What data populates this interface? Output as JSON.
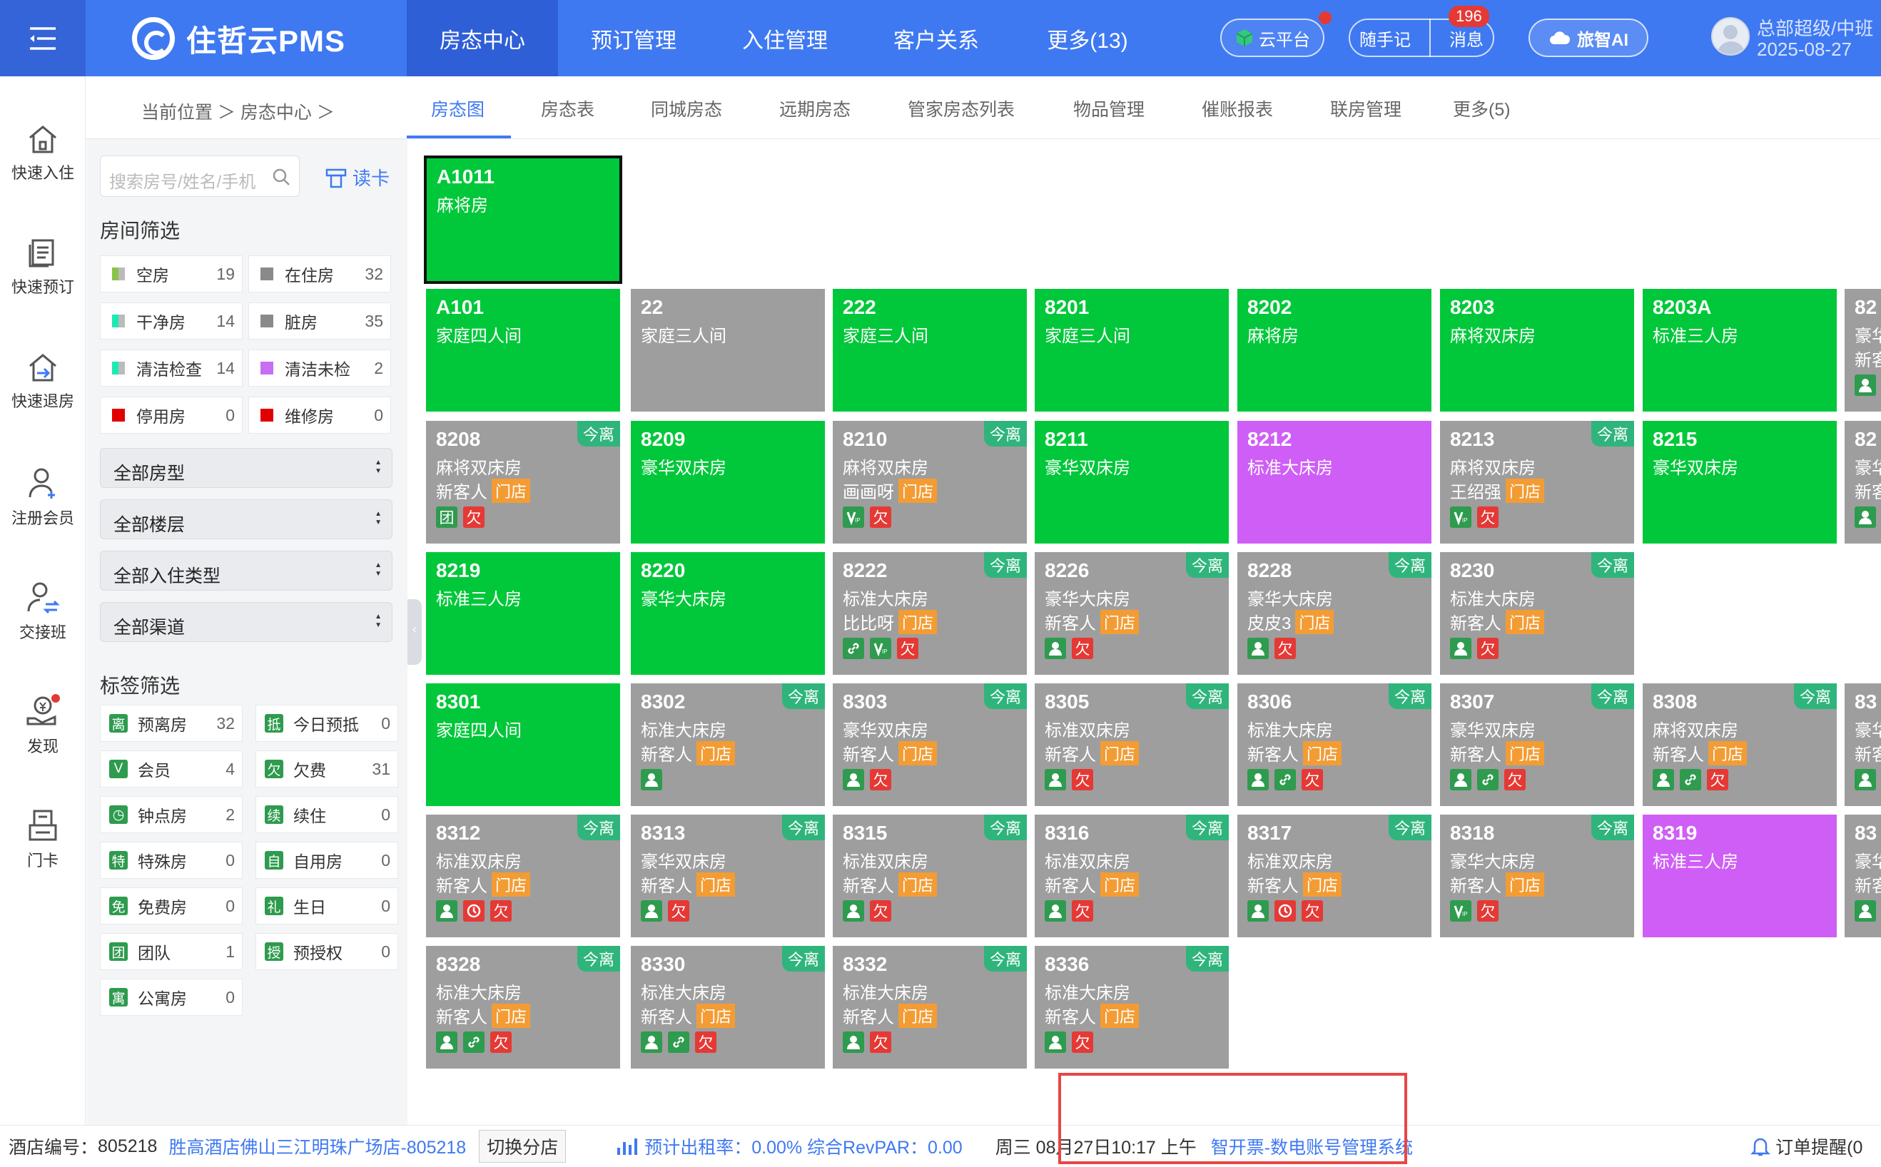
{
  "topbar": {
    "logo_text": "住哲云PMS",
    "nav": [
      "房态中心",
      "预订管理",
      "入住管理",
      "客户关系",
      "更多(13)"
    ],
    "active_nav": "房态中心",
    "cloud_platform": "云平台",
    "note": "随手记",
    "message": "消息",
    "message_badge": "196",
    "ai_label": "旅智AI",
    "user_name": "总部超级/中班",
    "user_date": "2025-08-27"
  },
  "rail": [
    "快速入住",
    "快速预订",
    "快速退房",
    "注册会员",
    "交接班",
    "发现",
    "门卡"
  ],
  "breadcrumb": "当前位置 ＞ 房态中心 ＞",
  "subtabs": [
    "房态图",
    "房态表",
    "同城房态",
    "远期房态",
    "管家房态列表",
    "物品管理",
    "催账报表",
    "联房管理",
    "更多(5)"
  ],
  "filter": {
    "search_placeholder": "搜索房号/姓名/手机",
    "read_card": "读卡",
    "room_filter_title": "房间筛选",
    "stats": [
      {
        "label": "空房",
        "count": "19",
        "color": "#8bc34a"
      },
      {
        "label": "在住房",
        "count": "32",
        "color": "#8a8a8a"
      },
      {
        "label": "干净房",
        "count": "14",
        "color": "#1de9b6"
      },
      {
        "label": "脏房",
        "count": "35",
        "color": "#8a8a8a"
      },
      {
        "label": "清洁检查",
        "count": "14",
        "color": "#1de9b6"
      },
      {
        "label": "清洁未检",
        "count": "2",
        "color": "#c76ef5"
      },
      {
        "label": "停用房",
        "count": "0",
        "color": "#e00000"
      },
      {
        "label": "维修房",
        "count": "0",
        "color": "#e00000"
      }
    ],
    "selects": [
      "全部房型",
      "全部楼层",
      "全部入住类型",
      "全部渠道"
    ],
    "tag_filter_title": "标签筛选",
    "tags": [
      {
        "icon": "离",
        "label": "预离房",
        "count": "32"
      },
      {
        "icon": "抵",
        "label": "今日预抵",
        "count": "0"
      },
      {
        "icon": "V",
        "label": "会员",
        "count": "4"
      },
      {
        "icon": "欠",
        "label": "欠费",
        "count": "31"
      },
      {
        "icon": "◷",
        "label": "钟点房",
        "count": "2"
      },
      {
        "icon": "续",
        "label": "续住",
        "count": "0"
      },
      {
        "icon": "特",
        "label": "特殊房",
        "count": "0"
      },
      {
        "icon": "自",
        "label": "自用房",
        "count": "0"
      },
      {
        "icon": "免",
        "label": "免费房",
        "count": "0"
      },
      {
        "icon": "礼",
        "label": "生日",
        "count": "0"
      },
      {
        "icon": "团",
        "label": "团队",
        "count": "1"
      },
      {
        "icon": "授",
        "label": "预授权",
        "count": "0"
      },
      {
        "icon": "寓",
        "label": "公寓房",
        "count": "0"
      }
    ]
  },
  "rooms": [
    {
      "num": "A1011",
      "type": "麻将房",
      "color": "green",
      "selected": true
    },
    {
      "num": "A101",
      "type": "家庭四人间",
      "color": "green"
    },
    {
      "num": "22",
      "type": "家庭三人间",
      "color": "gray"
    },
    {
      "num": "222",
      "type": "家庭三人间",
      "color": "green"
    },
    {
      "num": "8201",
      "type": "家庭三人间",
      "color": "green"
    },
    {
      "num": "8202",
      "type": "麻将房",
      "color": "green"
    },
    {
      "num": "8203",
      "type": "麻将双床房",
      "color": "green"
    },
    {
      "num": "8203A",
      "type": "标准三人房",
      "color": "green"
    },
    {
      "num": "82",
      "type": "豪华",
      "guest": "新客",
      "color": "gray",
      "icons": [
        "person"
      ]
    },
    {
      "num": "8208",
      "type": "麻将双床房",
      "guest": "新客人",
      "store": true,
      "leave": true,
      "color": "gray",
      "icons": [
        "team",
        "owe"
      ]
    },
    {
      "num": "8209",
      "type": "豪华双床房",
      "color": "green"
    },
    {
      "num": "8210",
      "type": "麻将双床房",
      "guest": "画画呀",
      "store": true,
      "leave": true,
      "color": "gray",
      "icons": [
        "vip",
        "owe"
      ]
    },
    {
      "num": "8211",
      "type": "豪华双床房",
      "color": "green"
    },
    {
      "num": "8212",
      "type": "标准大床房",
      "color": "purple"
    },
    {
      "num": "8213",
      "type": "麻将双床房",
      "guest": "王绍强",
      "store": true,
      "leave": true,
      "color": "gray",
      "icons": [
        "vip",
        "owe"
      ]
    },
    {
      "num": "8215",
      "type": "豪华双床房",
      "color": "green"
    },
    {
      "num": "82",
      "type": "豪华",
      "guest": "新客",
      "color": "gray",
      "icons": [
        "person"
      ]
    },
    {
      "num": "8219",
      "type": "标准三人房",
      "color": "green"
    },
    {
      "num": "8220",
      "type": "豪华大床房",
      "color": "green"
    },
    {
      "num": "8222",
      "type": "标准大床房",
      "guest": "比比呀",
      "store": true,
      "leave": true,
      "color": "gray",
      "icons": [
        "link",
        "vip",
        "owe"
      ]
    },
    {
      "num": "8226",
      "type": "豪华大床房",
      "guest": "新客人",
      "store": true,
      "leave": true,
      "color": "gray",
      "icons": [
        "person",
        "owe"
      ]
    },
    {
      "num": "8228",
      "type": "豪华大床房",
      "guest": "皮皮3",
      "store": true,
      "leave": true,
      "color": "gray",
      "icons": [
        "person",
        "owe"
      ]
    },
    {
      "num": "8230",
      "type": "标准大床房",
      "guest": "新客人",
      "store": true,
      "leave": true,
      "color": "gray",
      "icons": [
        "person",
        "owe"
      ]
    },
    {
      "num": "8301",
      "type": "家庭四人间",
      "color": "green"
    },
    {
      "num": "8302",
      "type": "标准大床房",
      "guest": "新客人",
      "store": true,
      "leave": true,
      "color": "gray",
      "icons": [
        "person"
      ]
    },
    {
      "num": "8303",
      "type": "豪华双床房",
      "guest": "新客人",
      "store": true,
      "leave": true,
      "color": "gray",
      "icons": [
        "person",
        "owe"
      ]
    },
    {
      "num": "8305",
      "type": "标准双床房",
      "guest": "新客人",
      "store": true,
      "leave": true,
      "color": "gray",
      "icons": [
        "person",
        "owe"
      ]
    },
    {
      "num": "8306",
      "type": "标准大床房",
      "guest": "新客人",
      "store": true,
      "leave": true,
      "color": "gray",
      "icons": [
        "person",
        "link",
        "owe"
      ]
    },
    {
      "num": "8307",
      "type": "豪华双床房",
      "guest": "新客人",
      "store": true,
      "leave": true,
      "color": "gray",
      "icons": [
        "person",
        "link",
        "owe"
      ]
    },
    {
      "num": "8308",
      "type": "麻将双床房",
      "guest": "新客人",
      "store": true,
      "leave": true,
      "color": "gray",
      "icons": [
        "person",
        "link",
        "owe"
      ]
    },
    {
      "num": "83",
      "type": "豪华",
      "guest": "新客",
      "color": "gray",
      "icons": [
        "person"
      ]
    },
    {
      "num": "8312",
      "type": "标准双床房",
      "guest": "新客人",
      "store": true,
      "leave": true,
      "color": "gray",
      "icons": [
        "person",
        "clock",
        "owe"
      ]
    },
    {
      "num": "8313",
      "type": "豪华双床房",
      "guest": "新客人",
      "store": true,
      "leave": true,
      "color": "gray",
      "icons": [
        "person",
        "owe"
      ]
    },
    {
      "num": "8315",
      "type": "标准双床房",
      "guest": "新客人",
      "store": true,
      "leave": true,
      "color": "gray",
      "icons": [
        "person",
        "owe"
      ]
    },
    {
      "num": "8316",
      "type": "标准双床房",
      "guest": "新客人",
      "store": true,
      "leave": true,
      "color": "gray",
      "icons": [
        "person",
        "owe"
      ]
    },
    {
      "num": "8317",
      "type": "标准双床房",
      "guest": "新客人",
      "store": true,
      "leave": true,
      "color": "gray",
      "icons": [
        "person",
        "clock",
        "owe"
      ]
    },
    {
      "num": "8318",
      "type": "豪华大床房",
      "guest": "新客人",
      "store": true,
      "leave": true,
      "color": "gray",
      "icons": [
        "vip",
        "owe"
      ]
    },
    {
      "num": "8319",
      "type": "标准三人房",
      "color": "purple"
    },
    {
      "num": "83",
      "type": "豪华",
      "guest": "新客",
      "color": "gray",
      "icons": [
        "person"
      ]
    },
    {
      "num": "8328",
      "type": "标准大床房",
      "guest": "新客人",
      "store": true,
      "leave": true,
      "color": "gray",
      "icons": [
        "person",
        "link",
        "owe"
      ]
    },
    {
      "num": "8330",
      "type": "标准大床房",
      "guest": "新客人",
      "store": true,
      "leave": true,
      "color": "gray",
      "icons": [
        "person",
        "link",
        "owe"
      ]
    },
    {
      "num": "8332",
      "type": "标准大床房",
      "guest": "新客人",
      "store": true,
      "leave": true,
      "color": "gray",
      "icons": [
        "person",
        "owe"
      ]
    },
    {
      "num": "8336",
      "type": "标准大床房",
      "guest": "新客人",
      "store": true,
      "leave": true,
      "color": "gray",
      "icons": [
        "person",
        "owe"
      ]
    }
  ],
  "room_labels": {
    "store": "门店",
    "leave": "今离",
    "owe": "欠",
    "team": "团"
  },
  "status": {
    "hotel_no_label": "酒店编号：",
    "hotel_no": "805218",
    "hotel_name": "胜高酒店佛山三江明珠广场店-805218",
    "switch": "切换分店",
    "forecast": "预计出租率：0.00%  综合RevPAR：0.00",
    "datetime": "周三 08月27日10:17 上午",
    "invoice": "智开票-数电账号管理系统",
    "order_remind": "订单提醒(0"
  },
  "colors": {
    "primary": "#3f79f2",
    "room_green": "#00c83a",
    "room_gray": "#9e9e9e",
    "room_purple": "#cf5ef6",
    "owe_red": "#e53935",
    "store_orange": "#f39c34"
  }
}
